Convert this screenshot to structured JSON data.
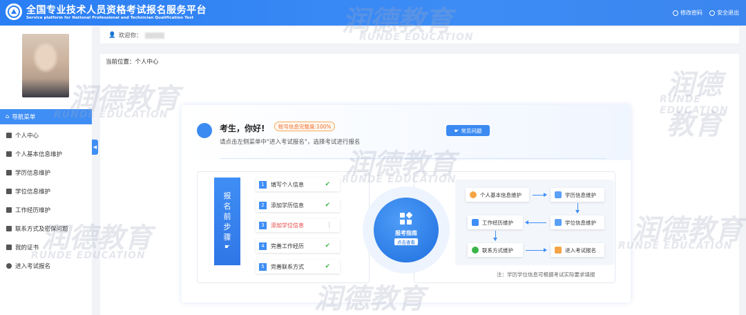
{
  "header": {
    "title": "全国专业技术人员资格考试报名服务平台",
    "subtitle": "Service platform for National Professional and Technician Qualification Test",
    "change_password": "修改密码",
    "logout": "安全退出"
  },
  "welcome": {
    "label": "欢迎你："
  },
  "breadcrumb": "当前位置：个人中心",
  "sidebar": {
    "nav_header": "导航菜单",
    "items": [
      {
        "label": "个人中心"
      },
      {
        "label": "个人基本信息维护"
      },
      {
        "label": "学历信息维护"
      },
      {
        "label": "学位信息维护"
      },
      {
        "label": "工作经历维护"
      },
      {
        "label": "联系方式及密保问题"
      },
      {
        "label": "我的证书"
      },
      {
        "label": "进入考试报名"
      }
    ]
  },
  "main": {
    "greeting": "考生，你好!",
    "completion_badge": "账号信息完整度:100%",
    "hint": "请点击左侧菜单中\"进入考试报名\"，选择考试进行报名",
    "faq_button": "常见问题",
    "steps_label": [
      "报",
      "名",
      "前",
      "步",
      "骤"
    ],
    "steps": [
      {
        "num": "1",
        "text": "填写个人信息",
        "done": true
      },
      {
        "num": "2",
        "text": "添加学历信息",
        "done": true
      },
      {
        "num": "3",
        "text": "添加学位信息",
        "done": false
      },
      {
        "num": "4",
        "text": "完善工作经历",
        "done": true
      },
      {
        "num": "5",
        "text": "完善联系方式",
        "done": true
      }
    ],
    "guide_title": "报考指南",
    "guide_button": "点击查看",
    "flow": {
      "personal": "个人基本信息维护",
      "education": "学历信息维护",
      "degree": "学位信息维护",
      "work": "工作经历维护",
      "contact": "联系方式维护",
      "enter": "进入考试报名"
    },
    "note": "注：学历学位信息可根据考试实际要求填报"
  },
  "watermark": {
    "cn": "润德教育",
    "en": "RUNDE EDUCATION"
  },
  "colors": {
    "primary": "#3f8ef5",
    "success": "#3ab54a",
    "warning": "#f06d2b",
    "danger": "#e84545"
  }
}
